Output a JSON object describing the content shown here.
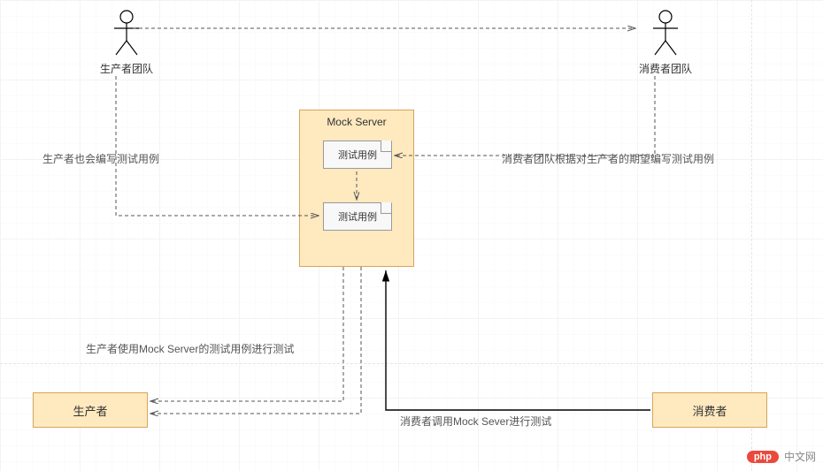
{
  "actors": {
    "producer_team": {
      "label": "生产者团队"
    },
    "consumer_team": {
      "label": "消费者团队"
    }
  },
  "mock_server": {
    "title": "Mock Server",
    "testcase1": "测试用例",
    "testcase2": "测试用例"
  },
  "entities": {
    "producer": "生产者",
    "consumer": "消费者"
  },
  "edges": {
    "producer_team_writes": "生产者也会编写测试用例",
    "consumer_team_writes": "消费者团队根据对生产者的期望编写测试用例",
    "producer_tests": "生产者使用Mock Server的测试用例进行测试",
    "consumer_calls": "消费者调用Mock Sever进行测试"
  },
  "watermark": {
    "badge": "php",
    "text": "中文网"
  }
}
